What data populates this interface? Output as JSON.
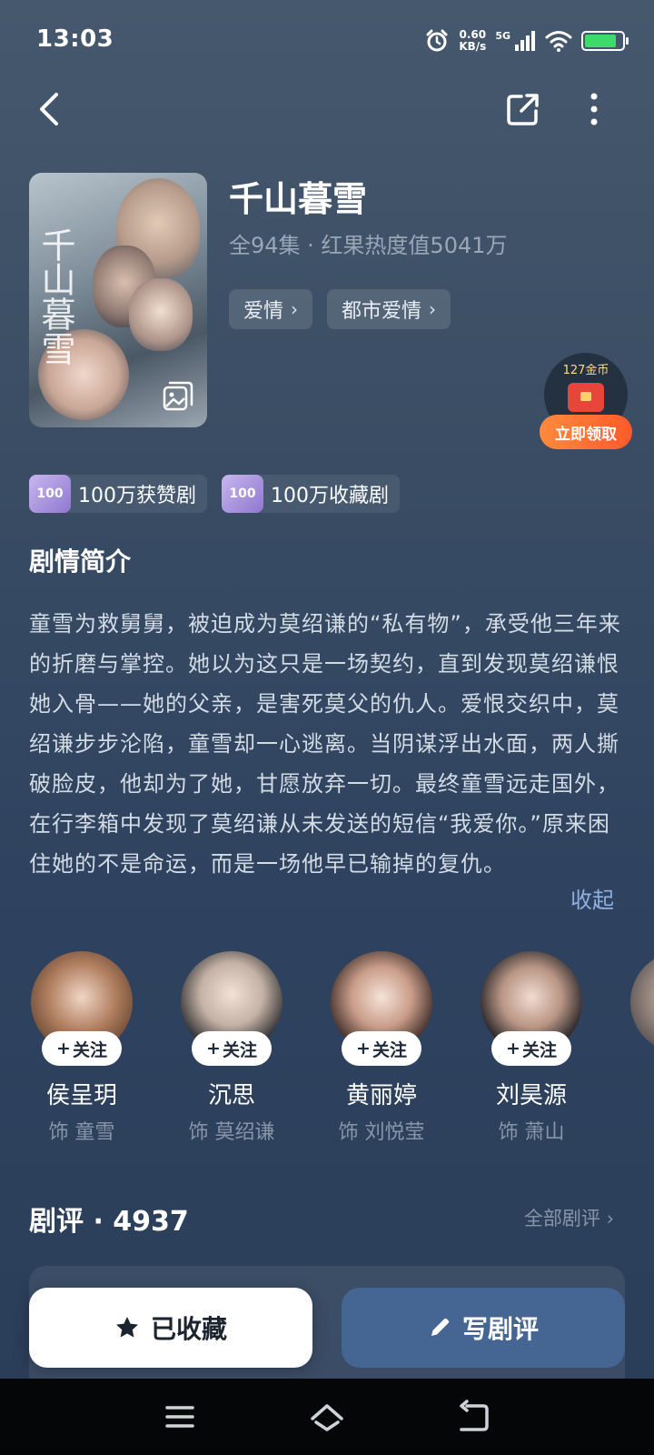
{
  "status_bar": {
    "time": "13:03",
    "net_speed_value": "0.60",
    "net_speed_unit": "KB/s",
    "network_type": "5G",
    "battery_level": 0.85,
    "battery_color": "#3ddc6a"
  },
  "show": {
    "title": "千山暮雪",
    "meta": "全94集 · 红果热度值5041万",
    "tags": [
      {
        "label": "爱情"
      },
      {
        "label": "都市爱情"
      }
    ]
  },
  "reward": {
    "coins": "127金币",
    "button_label": "立即领取"
  },
  "badges": [
    {
      "icon_text": "100",
      "label": "100万获赞剧"
    },
    {
      "icon_text": "100",
      "label": "100万收藏剧"
    }
  ],
  "synopsis": {
    "heading": "剧情简介",
    "text": "童雪为救舅舅，被迫成为莫绍谦的“私有物”，承受他三年来的折磨与掌控。她以为这只是一场契约，直到发现莫绍谦恨她入骨——她的父亲，是害死莫父的仇人。爱恨交织中，莫绍谦步步沦陷，童雪却一心逃离。当阴谋浮出水面，两人撕破脸皮，他却为了她，甘愿放弃一切。最终童雪远走国外，在行李箱中发现了莫绍谦从未发送的短信“我爱你。”原来困住她的不是命运，而是一场他早已输掉的复仇。",
    "collapse_label": "收起"
  },
  "cast": {
    "follow_label": "关注",
    "members": [
      {
        "name": "侯呈玥",
        "role": "饰 童雪"
      },
      {
        "name": "沉思",
        "role": "饰 莫绍谦"
      },
      {
        "name": "黄丽婷",
        "role": "饰 刘悦莹"
      },
      {
        "name": "刘昊源",
        "role": "饰 萧山"
      }
    ]
  },
  "reviews": {
    "title": "剧评 · 4937",
    "all_label": "全部剧评"
  },
  "actions": {
    "favorite_label": "已收藏",
    "review_label": "写剧评"
  },
  "colors": {
    "accent_link": "#8fb0e0",
    "primary_button": "#456593",
    "reward_orange": "#ff6a30"
  },
  "icons": {
    "back": "chevron-left-icon",
    "share": "share-icon",
    "more": "more-vertical-icon",
    "gallery": "gallery-icon",
    "star": "star-icon",
    "pencil": "pencil-icon"
  }
}
